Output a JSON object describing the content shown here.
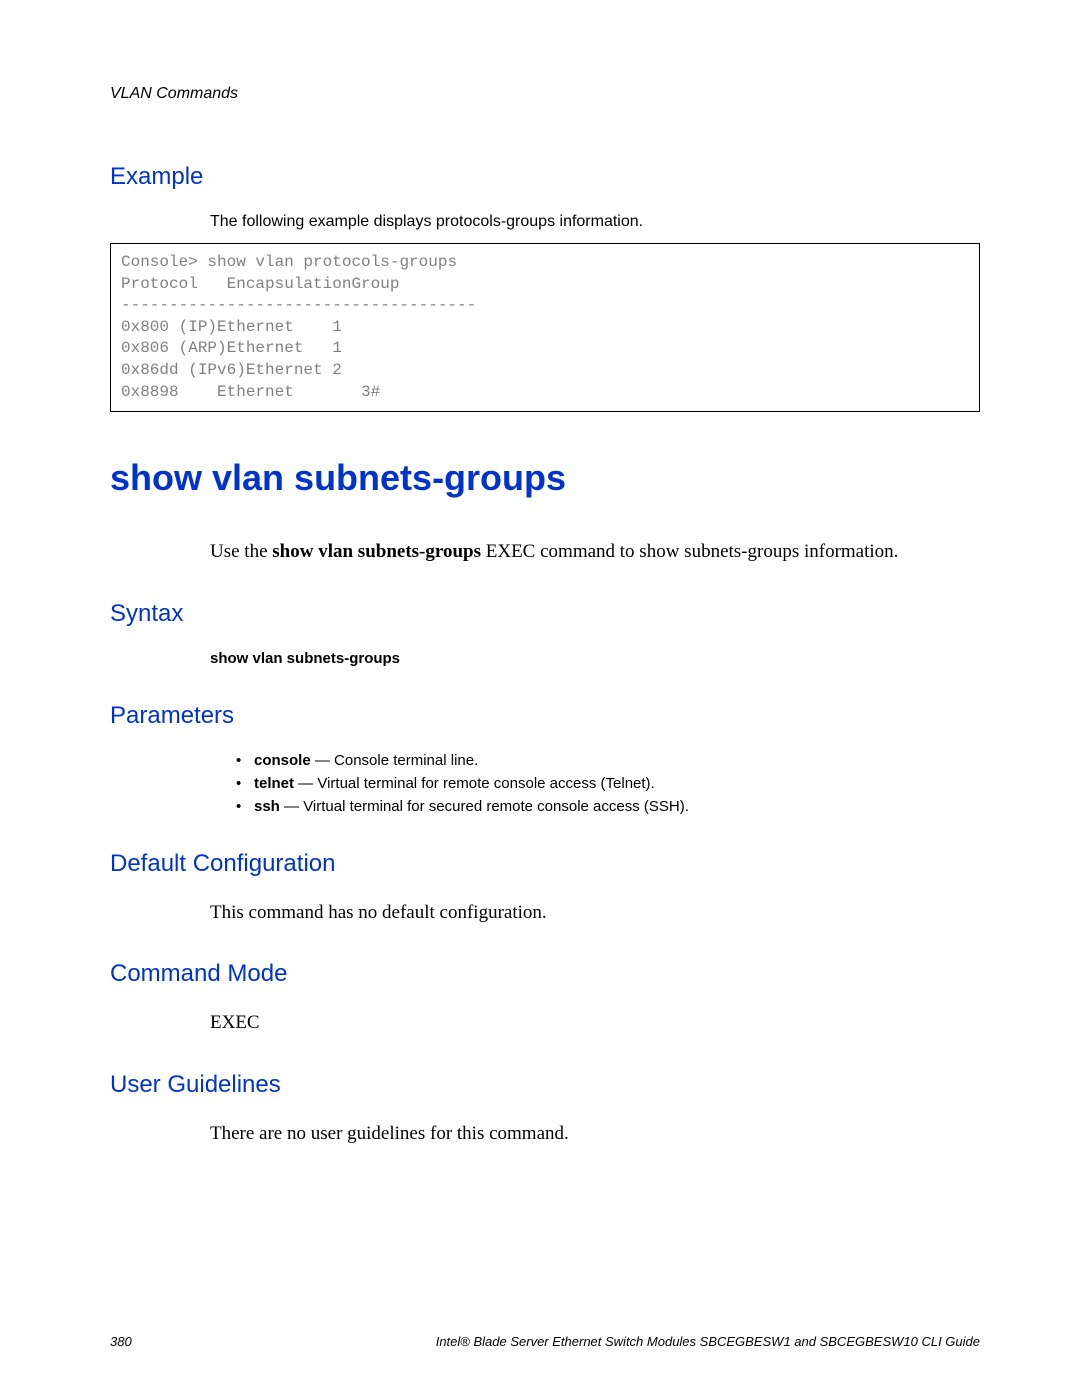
{
  "header": {
    "section": "VLAN Commands"
  },
  "example": {
    "heading": "Example",
    "intro": "The following example displays protocols-groups information.",
    "code": "Console> show vlan protocols-groups\nProtocol   EncapsulationGroup\n-------------------------------------\n0x800 (IP)Ethernet    1\n0x806 (ARP)Ethernet   1\n0x86dd (IPv6)Ethernet 2\n0x8898    Ethernet       3#"
  },
  "command": {
    "title": "show vlan subnets-groups",
    "description_pre": "Use the ",
    "description_bold": "show vlan subnets-groups",
    "description_post": " EXEC command to show subnets-groups information."
  },
  "syntax": {
    "heading": "Syntax",
    "text": "show vlan subnets-groups"
  },
  "parameters": {
    "heading": "Parameters",
    "items": [
      {
        "name": "console",
        "desc": " — Console terminal line."
      },
      {
        "name": "telnet",
        "desc": " — Virtual terminal for remote console access (Telnet)."
      },
      {
        "name": "ssh",
        "desc": " — Virtual terminal for secured remote console access (SSH)."
      }
    ]
  },
  "default_config": {
    "heading": "Default Configuration",
    "text": "This command has no default configuration."
  },
  "command_mode": {
    "heading": "Command Mode",
    "text": "EXEC"
  },
  "user_guidelines": {
    "heading": "User Guidelines",
    "text": "There are no user guidelines for this command."
  },
  "footer": {
    "page": "380",
    "doc": "Intel® Blade Server Ethernet Switch Modules SBCEGBESW1 and SBCEGBESW10 CLI Guide"
  }
}
